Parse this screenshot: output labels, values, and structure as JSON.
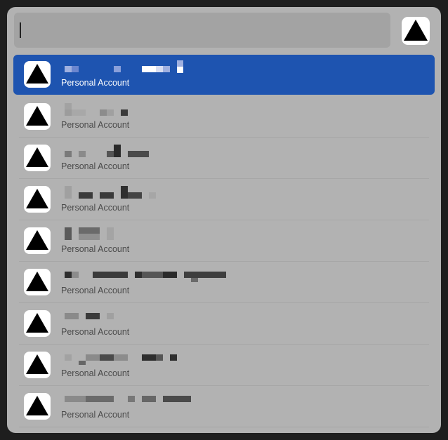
{
  "search": {
    "query": ""
  },
  "top_icon": "vercel-triangle-icon",
  "results": [
    {
      "subtitle": "Personal Account",
      "selected": true,
      "icon": "vercel-triangle-icon"
    },
    {
      "subtitle": "Personal Account",
      "selected": false,
      "icon": "vercel-triangle-icon"
    },
    {
      "subtitle": "Personal Account",
      "selected": false,
      "icon": "vercel-triangle-icon"
    },
    {
      "subtitle": "Personal Account",
      "selected": false,
      "icon": "vercel-triangle-icon"
    },
    {
      "subtitle": "Personal Account",
      "selected": false,
      "icon": "vercel-triangle-icon"
    },
    {
      "subtitle": "Personal Account",
      "selected": false,
      "icon": "vercel-triangle-icon"
    },
    {
      "subtitle": "Personal Account",
      "selected": false,
      "icon": "vercel-triangle-icon"
    },
    {
      "subtitle": "Personal Account",
      "selected": false,
      "icon": "vercel-triangle-icon"
    },
    {
      "subtitle": "Personal Account",
      "selected": false,
      "icon": "vercel-triangle-icon"
    }
  ],
  "colors": {
    "selection": "#1e54b0",
    "panel": "#b2b2b2",
    "search_field": "#a3a3a3"
  }
}
